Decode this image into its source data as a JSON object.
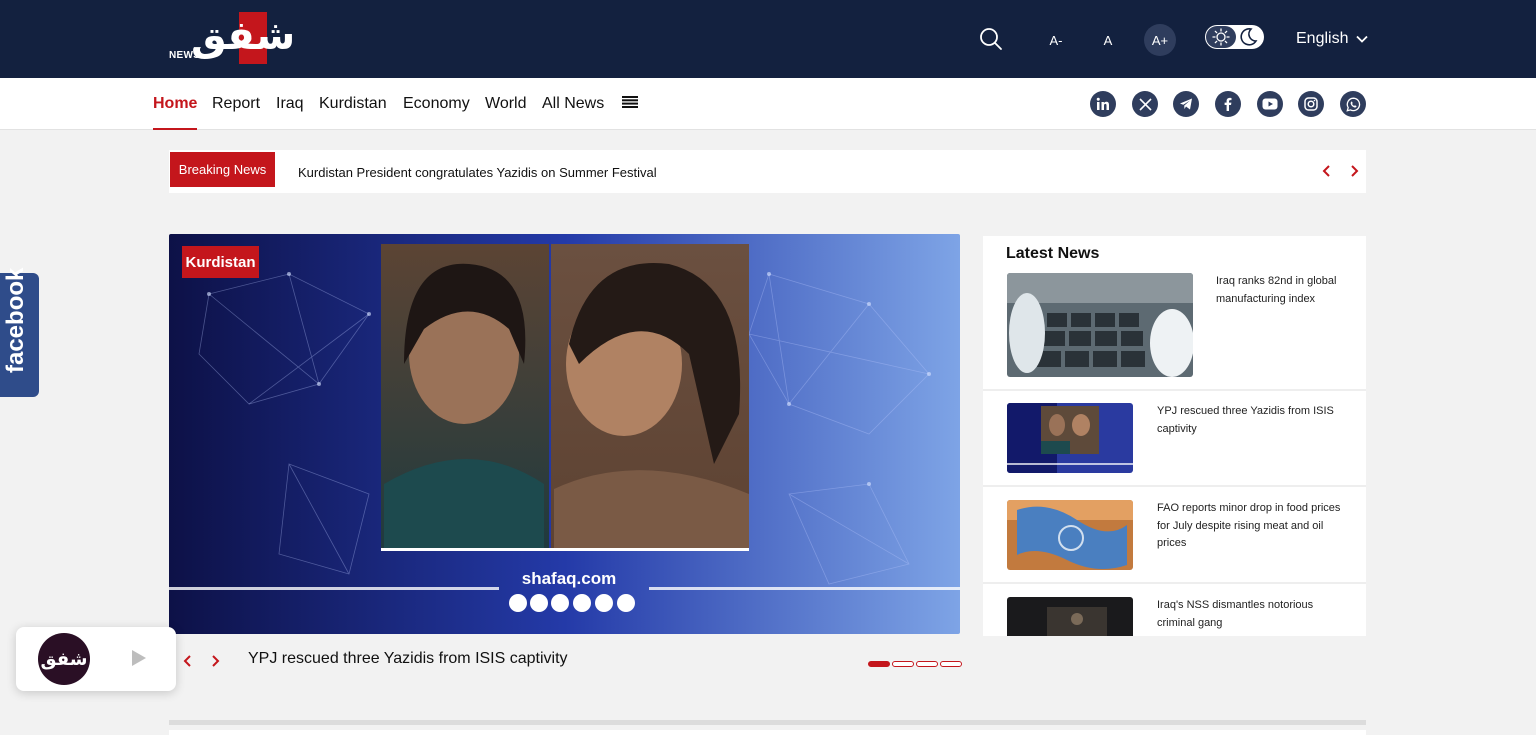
{
  "header": {
    "logo_arabic": "شفق",
    "logo_news": "NEWS",
    "font_small": "A-",
    "font_normal": "A",
    "font_large": "A+",
    "language": "English"
  },
  "nav": {
    "items": [
      "Home",
      "Report",
      "Iraq",
      "Kurdistan",
      "Economy",
      "World",
      "All News"
    ],
    "active": "Home"
  },
  "social": [
    "linkedin-icon",
    "x-icon",
    "telegram-icon",
    "facebook-icon",
    "youtube-icon",
    "instagram-icon",
    "whatsapp-icon"
  ],
  "breaking": {
    "label": "Breaking News",
    "text": "Kurdistan President congratulates Yazidis on Summer Festival"
  },
  "hero": {
    "tag": "Kurdistan",
    "watermark": "shafaq.com",
    "caption": "YPJ rescued three Yazidis from ISIS captivity",
    "slides": 4,
    "active_slide": 1
  },
  "latest": {
    "title": "Latest News",
    "items": [
      "Iraq ranks 82nd in global manufacturing index",
      "YPJ rescued three Yazidis from ISIS captivity",
      "FAO reports minor drop in food prices for July despite rising meat and oil prices",
      "Iraq's NSS dismantles notorious criminal gang"
    ]
  },
  "side": {
    "facebook_label": "facebook"
  },
  "radio": {
    "logo_text": "شفق"
  },
  "colors": {
    "header_bg": "#13213f",
    "accent_red": "#c4161c",
    "social_bg": "#2f3d5d",
    "facebook_blue": "#2f4c8a"
  }
}
